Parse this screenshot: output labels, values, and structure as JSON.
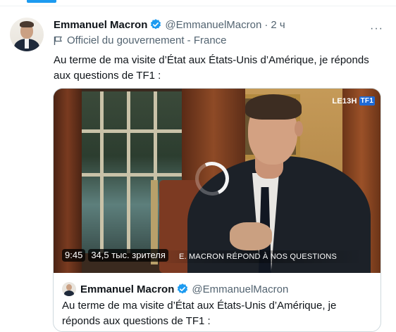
{
  "author": {
    "name": "Emmanuel Macron",
    "handle": "@EmmanuelMacron",
    "separator": "·",
    "time": "2 ч",
    "label": "Officiel du gouvernement - France"
  },
  "tweet": {
    "text": "Au terme de ma visite d’État aux États-Unis d’Amérique, je réponds aux questions de TF1 :"
  },
  "video": {
    "duration": "9:45",
    "views": "34,5 тыс. зрителя",
    "logo_prefix": "LE13H",
    "logo_brand": "TF1",
    "subtitle": "E. MACRON RÉPOND À NOS QUESTIONS"
  },
  "quoted": {
    "name": "Emmanuel Macron",
    "handle": "@EmmanuelMacron",
    "text": "Au terme de ma visite d’État aux États-Unis d’Amérique, je réponds aux questions de TF1 :"
  },
  "icons": {
    "more": "more-icon",
    "verified": "verified-badge-icon",
    "flag": "flag-icon",
    "spinner": "loading-spinner-icon"
  },
  "colors": {
    "accent": "#1d9bf0",
    "secondary_text": "#536471",
    "border": "#cfd9de"
  }
}
